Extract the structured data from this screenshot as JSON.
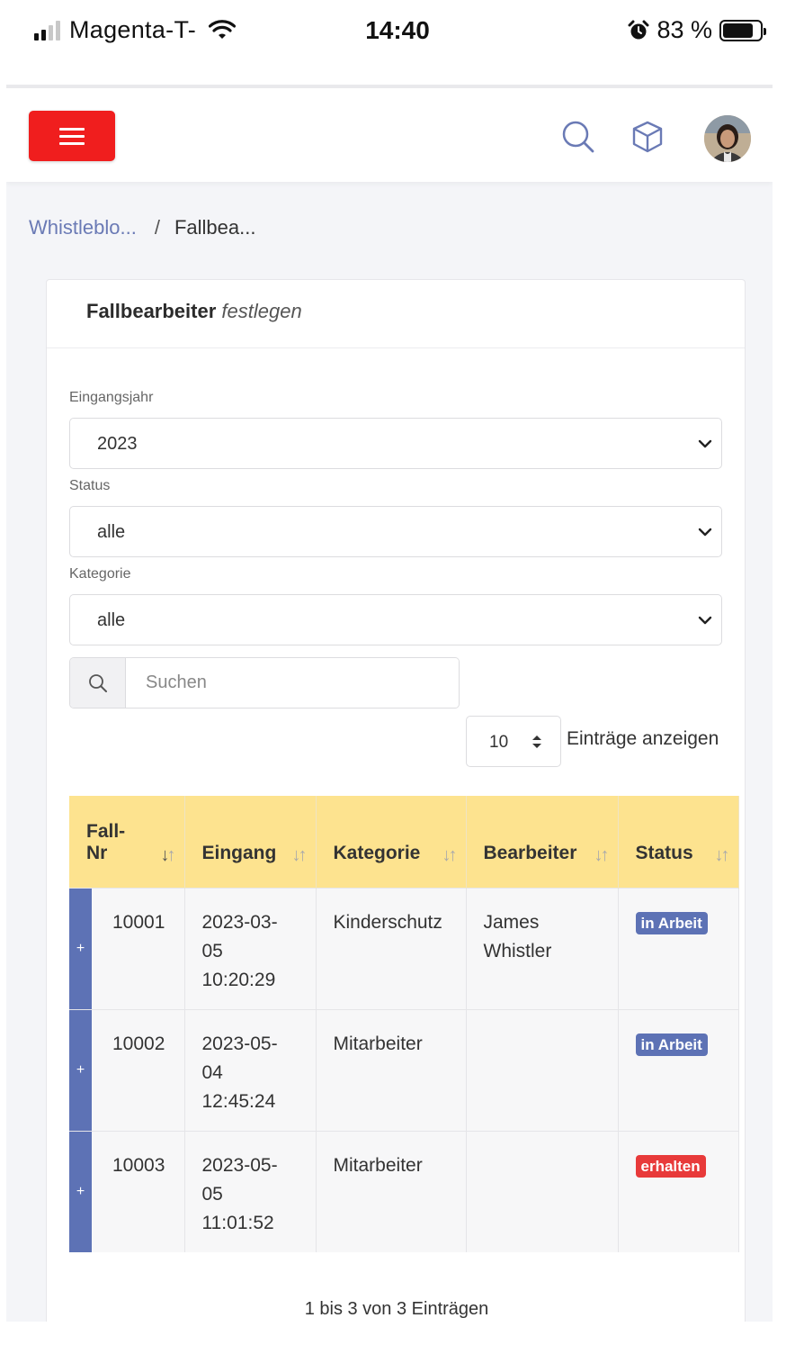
{
  "status_bar": {
    "carrier": "Magenta-T-",
    "time": "14:40",
    "battery_percent": "83 %",
    "battery_level": 0.83,
    "icons": [
      "signal-icon",
      "wifi-icon",
      "alarm-icon",
      "battery-icon"
    ]
  },
  "navbar": {
    "icons": [
      "menu-icon",
      "search-icon",
      "cube-icon",
      "avatar"
    ],
    "accent_color": "#f01e1e"
  },
  "breadcrumb": {
    "items": [
      "Whistleblo...",
      "Fallbea..."
    ],
    "separator": "/"
  },
  "card": {
    "title_main": "Fallbearbeiter",
    "title_emphasis": "festlegen"
  },
  "filters": {
    "year_label": "Eingangsjahr",
    "year_value": "2023",
    "status_label": "Status",
    "status_value": "alle",
    "category_label": "Kategorie",
    "category_value": "alle"
  },
  "search": {
    "placeholder": "Suchen"
  },
  "length": {
    "value": "10",
    "label": "Einträge anzeigen"
  },
  "table": {
    "header_color": "#fde38f",
    "columns": [
      "Fall-Nr",
      "Eingang",
      "Kategorie",
      "Bearbeiter",
      "Status"
    ],
    "rows": [
      {
        "fallnr": "10001",
        "eingang": "2023-03-05 10:20:29",
        "kategorie": "Kinderschutz",
        "bearbeiter": "James Whistler",
        "status": "in Arbeit",
        "status_color": "#5d72b5"
      },
      {
        "fallnr": "10002",
        "eingang": "2023-05-04 12:45:24",
        "kategorie": "Mitarbeiter",
        "bearbeiter": "",
        "status": "in Arbeit",
        "status_color": "#5d72b5"
      },
      {
        "fallnr": "10003",
        "eingang": "2023-05-05 11:01:52",
        "kategorie": "Mitarbeiter",
        "bearbeiter": "",
        "status": "erhalten",
        "status_color": "#e83a3a"
      }
    ],
    "expand_symbol": "+"
  },
  "footer_info": "1 bis 3 von 3 Einträgen"
}
